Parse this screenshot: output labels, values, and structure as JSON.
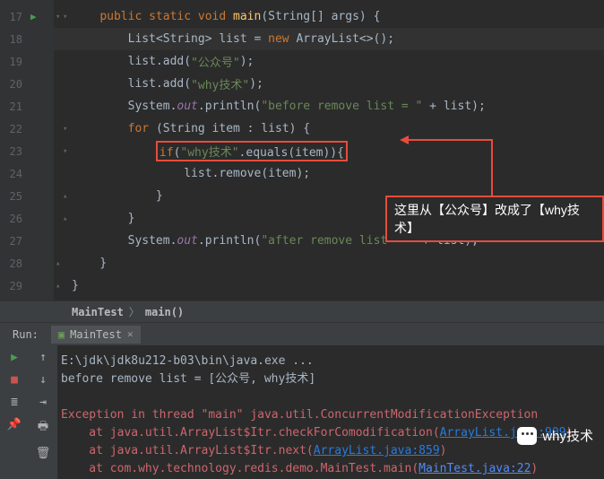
{
  "lines": [
    {
      "n": "17",
      "run": true,
      "f1": "▾",
      "f2": "▾",
      "seg": [
        {
          "t": "    ",
          "c": ""
        },
        {
          "t": "public static void ",
          "c": "kw"
        },
        {
          "t": "main",
          "c": "fn"
        },
        {
          "t": "(String[] args) {",
          "c": ""
        }
      ]
    },
    {
      "n": "18",
      "hl": true,
      "seg": [
        {
          "t": "        List<String> list = ",
          "c": ""
        },
        {
          "t": "new ",
          "c": "kw"
        },
        {
          "t": "ArrayList<>();",
          "c": ""
        }
      ]
    },
    {
      "n": "19",
      "seg": [
        {
          "t": "        list.add(",
          "c": ""
        },
        {
          "t": "\"公众号\"",
          "c": "str"
        },
        {
          "t": ");",
          "c": ""
        }
      ]
    },
    {
      "n": "20",
      "seg": [
        {
          "t": "        list.add(",
          "c": ""
        },
        {
          "t": "\"why技术\"",
          "c": "str"
        },
        {
          "t": ");",
          "c": ""
        }
      ]
    },
    {
      "n": "21",
      "seg": [
        {
          "t": "        System.",
          "c": ""
        },
        {
          "t": "out",
          "c": "st"
        },
        {
          "t": ".println(",
          "c": ""
        },
        {
          "t": "\"before remove list = \"",
          "c": "str"
        },
        {
          "t": " + list);",
          "c": ""
        }
      ]
    },
    {
      "n": "22",
      "f2": "▾",
      "seg": [
        {
          "t": "        ",
          "c": ""
        },
        {
          "t": "for ",
          "c": "kw"
        },
        {
          "t": "(String item : list) {",
          "c": ""
        }
      ]
    },
    {
      "n": "23",
      "f2": "▾",
      "seg": [
        {
          "t": "            ",
          "c": ""
        },
        {
          "t": "if",
          "c": "kw",
          "box": true
        },
        {
          "t": "(",
          "c": "",
          "box": true
        },
        {
          "t": "\"why技术\"",
          "c": "str",
          "box": true
        },
        {
          "t": ".equals(item)){",
          "c": "",
          "box": true
        }
      ]
    },
    {
      "n": "24",
      "seg": [
        {
          "t": "                list.remove(item);",
          "c": ""
        }
      ]
    },
    {
      "n": "25",
      "f2": "▴",
      "seg": [
        {
          "t": "            }",
          "c": ""
        }
      ]
    },
    {
      "n": "26",
      "f2": "▴",
      "seg": [
        {
          "t": "        }",
          "c": ""
        }
      ]
    },
    {
      "n": "27",
      "seg": [
        {
          "t": "        System.",
          "c": ""
        },
        {
          "t": "out",
          "c": "st"
        },
        {
          "t": ".println(",
          "c": ""
        },
        {
          "t": "\"after remove list = \"",
          "c": "str"
        },
        {
          "t": " + list);",
          "c": ""
        }
      ]
    },
    {
      "n": "28",
      "f1": "▴",
      "seg": [
        {
          "t": "    }",
          "c": ""
        }
      ]
    },
    {
      "n": "29",
      "f1": "▴",
      "seg": [
        {
          "t": "}",
          "c": ""
        }
      ]
    }
  ],
  "callout": "这里从【公众号】改成了【why技术】",
  "crumb1": "MainTest",
  "crumb2": "main()",
  "runLabel": "Run:",
  "tabName": "MainTest",
  "out": {
    "l1": "E:\\jdk\\jdk8u212-b03\\bin\\java.exe ...",
    "l2": "before remove list = [公众号, why技术]",
    "l3": "Exception in thread \"main\" java.util.ConcurrentModificationException",
    "l4a": "    at java.util.ArrayList$Itr.checkForComodification(",
    "l4b": "ArrayList.java:909",
    "l4c": ")",
    "l5a": "    at java.util.ArrayList$Itr.next(",
    "l5b": "ArrayList.java:859",
    "l5c": ")",
    "l6a": "    at com.why.technology.redis.demo.MainTest.main(",
    "l6b": "MainTest.java:22",
    "l6c": ")"
  },
  "wm": "why技术"
}
